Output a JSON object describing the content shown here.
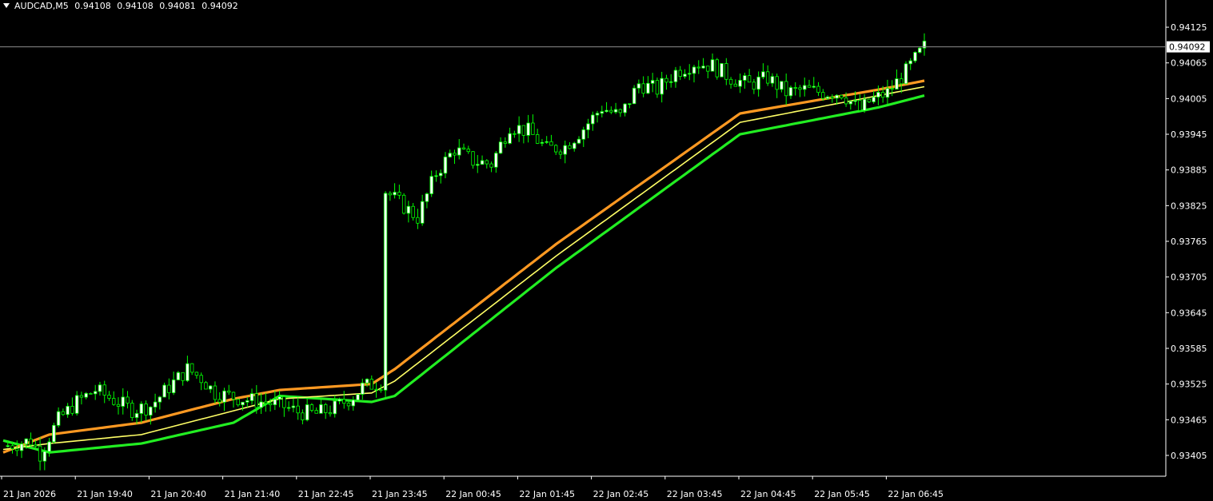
{
  "header": {
    "symbol": "AUDCAD,M5",
    "open": "0.94108",
    "high": "0.94108",
    "low": "0.94081",
    "close": "0.94092"
  },
  "colors": {
    "background": "#000000",
    "bull_candle": "#ffffff",
    "bear_candle": "#000000",
    "wick": "#00ff00",
    "upper_band": "#ff9922",
    "mid_band": "#ffff66",
    "lower_band": "#22ee22",
    "axis": "#ffffff",
    "price_line": "#8c8c8c"
  },
  "chart_data": {
    "type": "candlestick",
    "title": "",
    "ylim": [
      0.9337,
      0.9416
    ],
    "y_ticks": [
      "0.94125",
      "0.94065",
      "0.94005",
      "0.93945",
      "0.93885",
      "0.93825",
      "0.93765",
      "0.93705",
      "0.93645",
      "0.93585",
      "0.93525",
      "0.93465",
      "0.93405"
    ],
    "x_ticks": [
      "21 Jan 2026",
      "21 Jan 19:40",
      "21 Jan 20:40",
      "21 Jan 21:40",
      "21 Jan 22:45",
      "21 Jan 23:45",
      "22 Jan 00:45",
      "22 Jan 01:45",
      "22 Jan 02:45",
      "22 Jan 03:45",
      "22 Jan 04:45",
      "22 Jan 05:45",
      "22 Jan 06:45"
    ],
    "current_price": "0.94092",
    "close_path": [
      [
        0,
        0.9342
      ],
      [
        6,
        0.9343
      ],
      [
        8,
        0.93408
      ],
      [
        12,
        0.93465
      ],
      [
        16,
        0.93495
      ],
      [
        20,
        0.93515
      ],
      [
        24,
        0.93498
      ],
      [
        28,
        0.93482
      ],
      [
        32,
        0.93488
      ],
      [
        36,
        0.9352
      ],
      [
        40,
        0.9355
      ],
      [
        43,
        0.93535
      ],
      [
        46,
        0.9351
      ],
      [
        52,
        0.935
      ],
      [
        56,
        0.93495
      ],
      [
        60,
        0.9349
      ],
      [
        64,
        0.93478
      ],
      [
        68,
        0.93475
      ],
      [
        72,
        0.93485
      ],
      [
        76,
        0.93505
      ],
      [
        78,
        0.9352
      ],
      [
        82,
        0.93528
      ],
      [
        83,
        0.9385
      ],
      [
        86,
        0.9383
      ],
      [
        90,
        0.93805
      ],
      [
        94,
        0.9388
      ],
      [
        98,
        0.9392
      ],
      [
        102,
        0.939
      ],
      [
        106,
        0.93895
      ],
      [
        110,
        0.9396
      ],
      [
        114,
        0.9395
      ],
      [
        118,
        0.9392
      ],
      [
        122,
        0.93925
      ],
      [
        126,
        0.93955
      ],
      [
        130,
        0.9399
      ],
      [
        134,
        0.93975
      ],
      [
        138,
        0.9403
      ],
      [
        142,
        0.9402
      ],
      [
        146,
        0.9405
      ],
      [
        150,
        0.94065
      ],
      [
        154,
        0.9406
      ],
      [
        158,
        0.9404
      ],
      [
        162,
        0.94028
      ],
      [
        166,
        0.9404
      ],
      [
        170,
        0.94015
      ],
      [
        174,
        0.9402
      ],
      [
        178,
        0.94015
      ],
      [
        182,
        0.94015
      ],
      [
        186,
        0.93985
      ],
      [
        188,
        0.94
      ],
      [
        192,
        0.94015
      ],
      [
        196,
        0.9405
      ],
      [
        200,
        0.94092
      ]
    ],
    "bands": {
      "upper": [
        [
          0,
          0.9341
        ],
        [
          10,
          0.9344
        ],
        [
          30,
          0.9346
        ],
        [
          50,
          0.935
        ],
        [
          60,
          0.93515
        ],
        [
          80,
          0.93525
        ],
        [
          85,
          0.9355
        ],
        [
          120,
          0.9376
        ],
        [
          160,
          0.9398
        ],
        [
          190,
          0.9402
        ],
        [
          200,
          0.94035
        ]
      ],
      "middle": [
        [
          0,
          0.93415
        ],
        [
          10,
          0.93425
        ],
        [
          30,
          0.9344
        ],
        [
          50,
          0.9348
        ],
        [
          60,
          0.935
        ],
        [
          80,
          0.9351
        ],
        [
          85,
          0.9353
        ],
        [
          120,
          0.9374
        ],
        [
          160,
          0.93965
        ],
        [
          190,
          0.9401
        ],
        [
          200,
          0.94025
        ]
      ],
      "lower": [
        [
          0,
          0.9343
        ],
        [
          10,
          0.9341
        ],
        [
          30,
          0.93425
        ],
        [
          50,
          0.9346
        ],
        [
          60,
          0.93505
        ],
        [
          80,
          0.93495
        ],
        [
          85,
          0.93505
        ],
        [
          120,
          0.9372
        ],
        [
          160,
          0.93945
        ],
        [
          190,
          0.9399
        ],
        [
          200,
          0.9401
        ]
      ]
    }
  }
}
